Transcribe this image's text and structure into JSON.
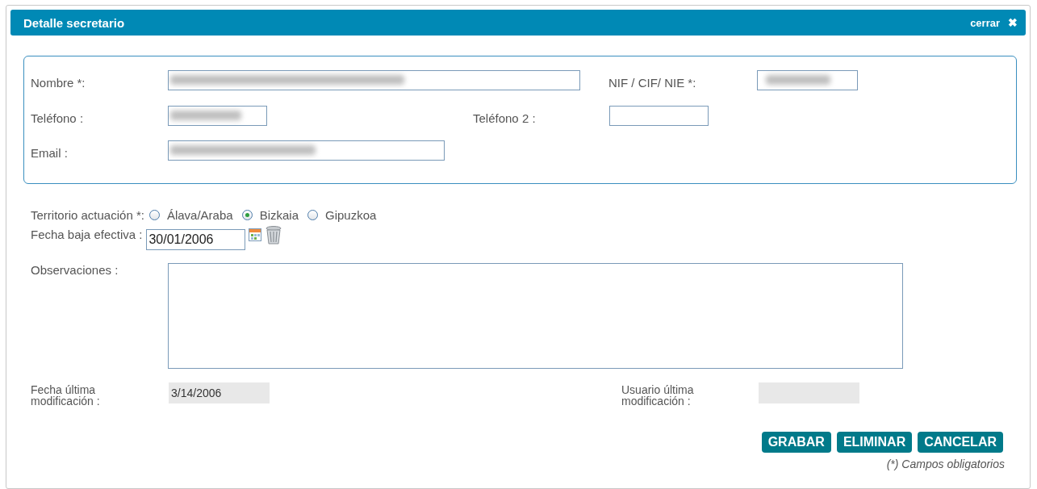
{
  "dialog": {
    "title": "Detalle secretario",
    "close_label": "cerrar",
    "close_glyph": "✖"
  },
  "contact": {
    "nombre": {
      "label": "Nombre *:",
      "blurred": true
    },
    "nif": {
      "label": "NIF / CIF/ NIE *:",
      "blurred": true
    },
    "telefono": {
      "label": "Teléfono :",
      "blurred": true
    },
    "telefono2": {
      "label": "Teléfono 2 :",
      "blurred": false
    },
    "email": {
      "label": "Email :",
      "blurred": true
    }
  },
  "territorio": {
    "label": "Territorio actuación *:",
    "options": [
      {
        "label": "Álava/Araba",
        "selected": false
      },
      {
        "label": "Bizkaia",
        "selected": true
      },
      {
        "label": "Gipuzkoa",
        "selected": false
      }
    ]
  },
  "fecha_baja": {
    "label": "Fecha baja efectiva :",
    "value": "30/01/2006"
  },
  "observaciones": {
    "label": "Observaciones :"
  },
  "fecha_modificacion": {
    "label": "Fecha última modificación :",
    "value": "3/14/2006"
  },
  "usuario_modificacion": {
    "label": "Usuario última modificación :"
  },
  "buttons": [
    "GRABAR",
    "ELIMINAR",
    "CANCELAR"
  ],
  "footnote": "(*) Campos obligatorios"
}
